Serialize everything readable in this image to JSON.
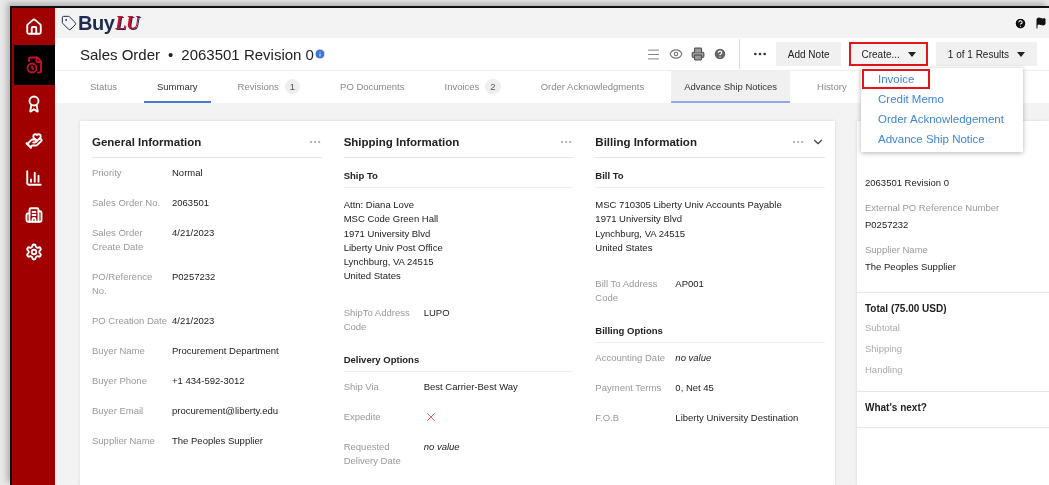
{
  "logo": {
    "word": "Buy",
    "mark": "LU"
  },
  "sidebar": {
    "items": [
      {
        "kind": "home",
        "selected": false
      },
      {
        "kind": "orders",
        "selected": true
      },
      {
        "kind": "award",
        "selected": false
      },
      {
        "kind": "charity",
        "selected": false
      },
      {
        "kind": "reports",
        "selected": false
      },
      {
        "kind": "suppliers",
        "selected": false
      },
      {
        "kind": "settings",
        "selected": false
      }
    ]
  },
  "header": {
    "title": "Sales Order",
    "separator": "•",
    "number": "2063501 Revision 0",
    "buttons": [
      {
        "kind": "plain",
        "label": "Add Note",
        "annotated": false
      },
      {
        "kind": "menu",
        "label": "Create...",
        "annotated": true
      },
      {
        "kind": "menu",
        "label": "1 of 1 Results",
        "annotated": false
      }
    ]
  },
  "tabs": [
    {
      "label": "Status",
      "selected": false,
      "hovered": false
    },
    {
      "label": "Summary",
      "selected": true,
      "hovered": false
    },
    {
      "label": "Revisions",
      "count": "1",
      "selected": false,
      "hovered": false
    },
    {
      "label": "PO Documents",
      "selected": false,
      "hovered": false
    },
    {
      "label": "Invoices",
      "count": "2",
      "selected": false,
      "hovered": false
    },
    {
      "label": "Order Acknowledgments",
      "selected": false,
      "hovered": false
    },
    {
      "label": "Advance Ship Notices",
      "selected": false,
      "hovered": true
    },
    {
      "label": "History",
      "selected": false,
      "hovered": false
    }
  ],
  "create_menu": {
    "items": [
      {
        "label": "Invoice",
        "annotated": true
      },
      {
        "label": "Credit Memo",
        "annotated": false
      },
      {
        "label": "Order Acknowledgement",
        "annotated": false
      },
      {
        "label": "Advance Ship Notice",
        "annotated": false
      }
    ]
  },
  "cards": [
    {
      "title": "General Information",
      "collapsible": false,
      "blocks": [
        {
          "kind": "field",
          "label": "Priority",
          "value": "Normal"
        },
        {
          "kind": "field",
          "label": "Sales Order No.",
          "value": "2063501"
        },
        {
          "kind": "field",
          "label": "Sales Order Create Date",
          "value": "4/21/2023"
        },
        {
          "kind": "field",
          "label": "PO/Reference No.",
          "value": "P0257232"
        },
        {
          "kind": "field",
          "label": "PO Creation Date",
          "value": "4/21/2023"
        },
        {
          "kind": "field",
          "label": "Buyer Name",
          "value": "Procurement Department"
        },
        {
          "kind": "field",
          "label": "Buyer Phone",
          "value": "+1 434-592-3012"
        },
        {
          "kind": "field",
          "label": "Buyer Email",
          "value": "procurement@liberty.edu"
        },
        {
          "kind": "field",
          "label": "Supplier Name",
          "value": "The Peoples Supplier"
        }
      ]
    },
    {
      "title": "Shipping Information",
      "collapsible": false,
      "blocks": [
        {
          "kind": "heading",
          "text": "Ship To"
        },
        {
          "kind": "address",
          "lines": [
            "Attn: Diana Love",
            "MSC Code Green Hall",
            "1971 University Blvd",
            "Liberty Univ Post Office",
            "Lynchburg, VA 24515",
            "United States"
          ]
        },
        {
          "kind": "field",
          "label": "ShipTo Address Code",
          "value": "LUPO"
        },
        {
          "kind": "heading",
          "text": "Delivery Options"
        },
        {
          "kind": "field",
          "label": "Ship Via",
          "value": "Best Carrier-Best Way"
        },
        {
          "kind": "cross",
          "label": "Expedite"
        },
        {
          "kind": "empty",
          "label": "Requested Delivery Date",
          "value": "no value"
        }
      ]
    },
    {
      "title": "Billing Information",
      "collapsible": true,
      "blocks": [
        {
          "kind": "heading",
          "text": "Bill To"
        },
        {
          "kind": "address",
          "lines": [
            "MSC 710305 Liberty Univ Accounts Payable",
            "1971 University Blvd",
            "Lynchburg, VA 24515",
            "United States"
          ]
        },
        {
          "kind": "field",
          "label": "Bill To Address Code",
          "value": "AP001"
        },
        {
          "kind": "heading",
          "text": "Billing Options"
        },
        {
          "kind": "empty",
          "label": "Accounting Date",
          "value": "no value"
        },
        {
          "kind": "field",
          "label": "Payment Terms",
          "value": "0, Net 45"
        },
        {
          "kind": "field",
          "label": "F.O.B",
          "value": "Liberty University Destination"
        }
      ]
    }
  ],
  "summary_panel": {
    "sections": [
      {
        "items": [
          {
            "value": "2063501 Revision 0"
          },
          {
            "label": "External PO Reference Number",
            "value": "P0257232"
          },
          {
            "label": "Supplier Name",
            "value": "The Peoples Supplier"
          }
        ]
      },
      {
        "title": "Total (75.00 USD)",
        "items": [
          {
            "label": "Subtotal"
          },
          {
            "label": "Shipping"
          },
          {
            "label": "Handling"
          }
        ]
      },
      {
        "title": "What's next?"
      }
    ]
  }
}
